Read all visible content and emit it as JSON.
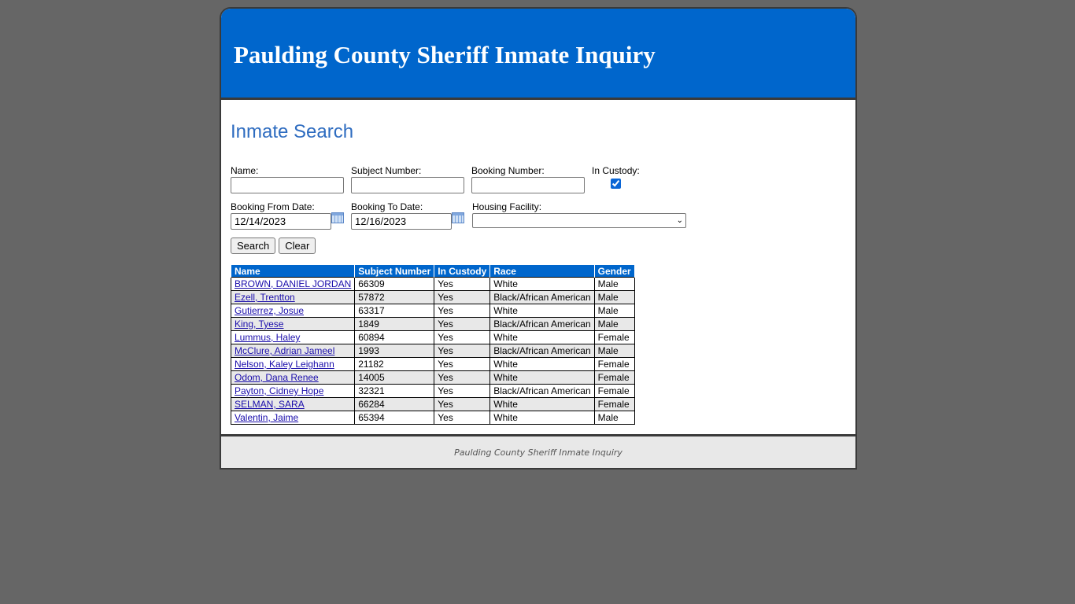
{
  "header": {
    "title": "Paulding County Sheriff Inmate Inquiry"
  },
  "search": {
    "title": "Inmate Search",
    "name_label": "Name:",
    "name_value": "",
    "subject_label": "Subject Number:",
    "subject_value": "",
    "booking_label": "Booking Number:",
    "booking_value": "",
    "custody_label": "In Custody:",
    "custody_checked": true,
    "from_label": "Booking From Date:",
    "from_value": "12/14/2023",
    "to_label": "Booking To Date:",
    "to_value": "12/16/2023",
    "facility_label": "Housing Facility:",
    "facility_value": "",
    "search_button": "Search",
    "clear_button": "Clear"
  },
  "results": {
    "columns": [
      "Name",
      "Subject Number",
      "In Custody",
      "Race",
      "Gender"
    ],
    "rows": [
      {
        "name": "BROWN, DANIEL JORDAN",
        "subject": "66309",
        "custody": "Yes",
        "race": "White",
        "gender": "Male"
      },
      {
        "name": "Ezell, Trentton",
        "subject": "57872",
        "custody": "Yes",
        "race": "Black/African American",
        "gender": "Male"
      },
      {
        "name": "Gutierrez, Josue",
        "subject": "63317",
        "custody": "Yes",
        "race": "White",
        "gender": "Male"
      },
      {
        "name": "King, Tyese",
        "subject": "1849",
        "custody": "Yes",
        "race": "Black/African American",
        "gender": "Male"
      },
      {
        "name": "Lummus, Haley",
        "subject": "60894",
        "custody": "Yes",
        "race": "White",
        "gender": "Female"
      },
      {
        "name": "McClure, Adrian Jameel",
        "subject": "1993",
        "custody": "Yes",
        "race": "Black/African American",
        "gender": "Male"
      },
      {
        "name": "Nelson, Kaley Leighann",
        "subject": "21182",
        "custody": "Yes",
        "race": "White",
        "gender": "Female"
      },
      {
        "name": "Odom, Dana Renee",
        "subject": "14005",
        "custody": "Yes",
        "race": "White",
        "gender": "Female"
      },
      {
        "name": "Payton, Cidney Hope",
        "subject": "32321",
        "custody": "Yes",
        "race": "Black/African American",
        "gender": "Female"
      },
      {
        "name": "SELMAN, SARA",
        "subject": "66284",
        "custody": "Yes",
        "race": "White",
        "gender": "Female"
      },
      {
        "name": "Valentin, Jaime",
        "subject": "65394",
        "custody": "Yes",
        "race": "White",
        "gender": "Male"
      }
    ]
  },
  "footer": {
    "text": "Paulding County Sheriff Inmate Inquiry"
  },
  "colors": {
    "banner": "#0066cc",
    "page_bg": "#666666",
    "heading": "#2e6cc0",
    "link": "#1a0dab"
  },
  "icons": {
    "calendar": "calendar-icon",
    "dropdown": "chevron-down-icon"
  }
}
